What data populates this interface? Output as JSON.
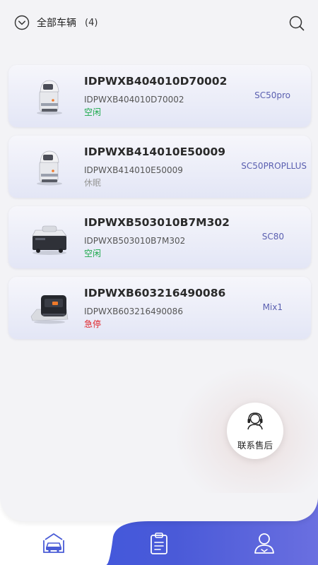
{
  "header": {
    "filter_label": "全部车辆",
    "filter_count": "(4)",
    "filter_icon": "chevron-down-circle-icon",
    "search_icon": "search-icon"
  },
  "vehicles": [
    {
      "title": "IDPWXB404010D70002",
      "serial": "IDPWXB404010D70002",
      "status": "空闲",
      "status_color": "#1aa84a",
      "model": "SC50pro",
      "thumb": "robot-sc50-thumbnail"
    },
    {
      "title": "IDPWXB414010E50009",
      "serial": "IDPWXB414010E50009",
      "status": "休眠",
      "status_color": "#9a9a9a",
      "model": "SC50PROPLLUS",
      "thumb": "robot-sc50-thumbnail"
    },
    {
      "title": "IDPWXB503010B7M302",
      "serial": "IDPWXB503010B7M302",
      "status": "空闲",
      "status_color": "#1aa84a",
      "model": "SC80",
      "thumb": "robot-sc80-thumbnail"
    },
    {
      "title": "IDPWXB603216490086",
      "serial": "IDPWXB603216490086",
      "status": "急停",
      "status_color": "#e0242a",
      "model": "Mix1",
      "thumb": "robot-mix1-thumbnail"
    }
  ],
  "support": {
    "label": "联系售后",
    "icon": "headset-icon"
  },
  "tabbar": {
    "tabs": [
      {
        "icon": "vehicle-icon",
        "active": true,
        "color": "#4a5cd6"
      },
      {
        "icon": "clipboard-icon",
        "active": false,
        "color": "#ffffff"
      },
      {
        "icon": "user-icon",
        "active": false,
        "color": "#ffffff"
      }
    ]
  }
}
